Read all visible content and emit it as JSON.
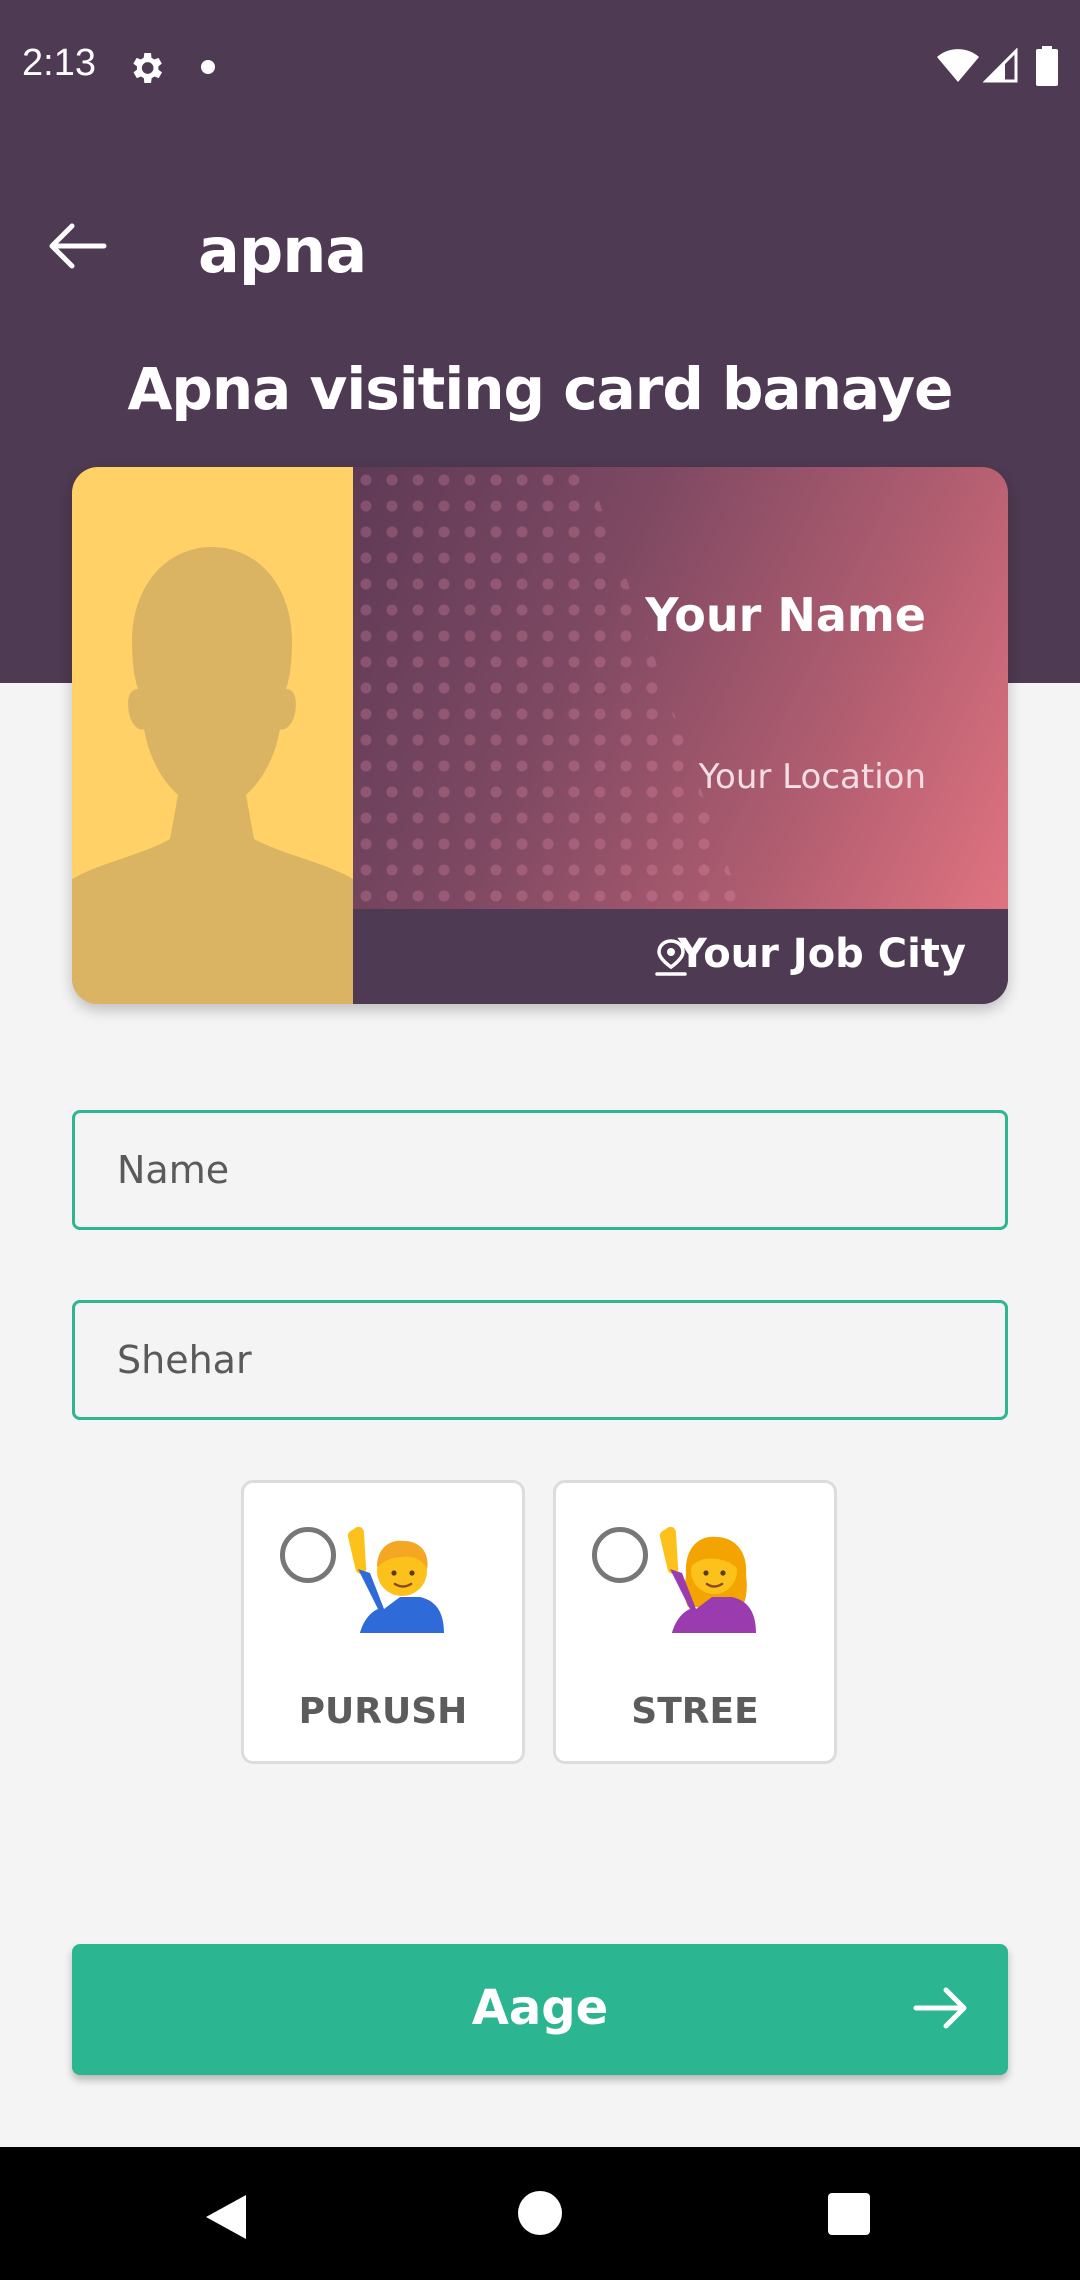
{
  "status_bar": {
    "time": "2:13",
    "icons": [
      "gear-icon",
      "notification-dot",
      "wifi-icon",
      "signal-icon",
      "battery-icon"
    ]
  },
  "header": {
    "back_icon": "arrow-left-icon",
    "brand": "apna",
    "title": "Apna visiting card banaye",
    "background_color": "#4e3a52"
  },
  "card_preview": {
    "name": "Your Name",
    "location": "Your Location",
    "job_city": "Your Job City",
    "photo_placeholder": "person-silhouette",
    "pin_icon": "location-pin-icon"
  },
  "form": {
    "name_placeholder": "Name",
    "city_placeholder": "Shehar",
    "field_border_color": "#2db68f",
    "gender_options": [
      {
        "label": "PURUSH",
        "emoji": "man-raising-hand",
        "selected": false
      },
      {
        "label": "STREE",
        "emoji": "woman-raising-hand",
        "selected": false
      }
    ]
  },
  "next_button": {
    "label": "Aage",
    "icon": "arrow-right-icon",
    "color": "#2bb691"
  },
  "nav_bar": {
    "icons": [
      "back-triangle-icon",
      "home-circle-icon",
      "recents-square-icon"
    ]
  }
}
